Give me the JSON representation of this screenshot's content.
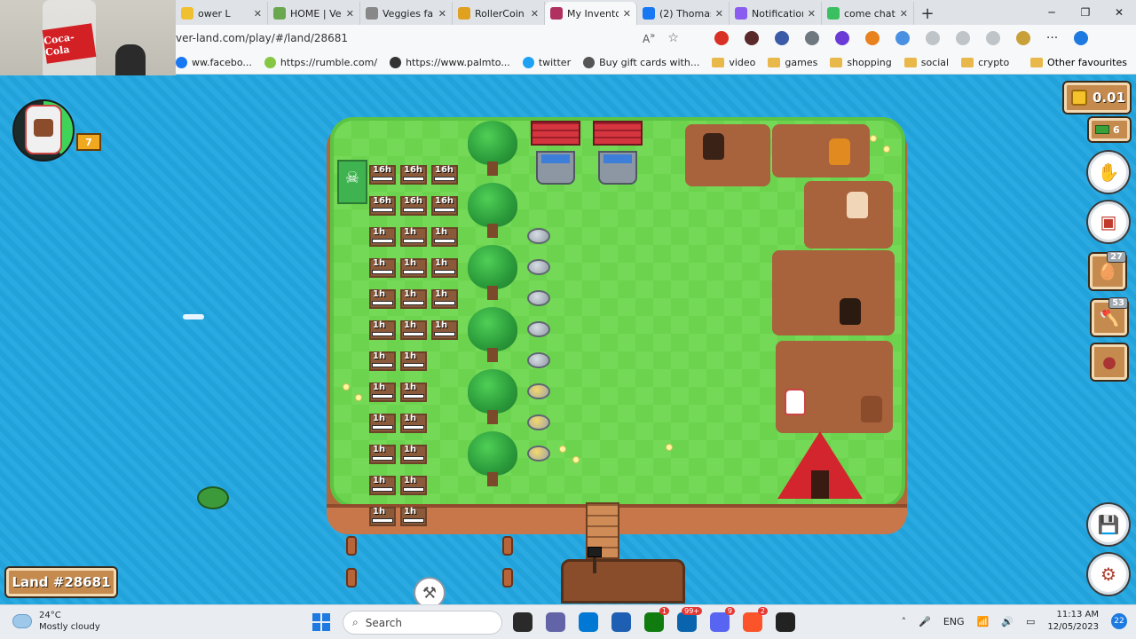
{
  "browser": {
    "tabs": [
      {
        "label": "ower L",
        "color": "#f0c030",
        "active": false
      },
      {
        "label": "HOME | Veg",
        "color": "#6aa84f",
        "active": false
      },
      {
        "label": "Veggies far",
        "color": "#888888",
        "active": false
      },
      {
        "label": "RollerCoin",
        "color": "#e0a020",
        "active": false
      },
      {
        "label": "My Inventor",
        "color": "#b03060",
        "active": true
      },
      {
        "label": "(2) Thomas",
        "color": "#1877f2",
        "active": false
      },
      {
        "label": "Notification",
        "color": "#8a5cf0",
        "active": false
      },
      {
        "label": "come chat",
        "color": "#3ac060",
        "active": false
      }
    ],
    "url": "ver-land.com/play/#/land/28681",
    "bookmarks": [
      {
        "label": "ww.facebo...",
        "icon": "facebook-icon"
      },
      {
        "label": "https://rumble.com/",
        "icon": "rumble-icon"
      },
      {
        "label": "https://www.palmto...",
        "icon": "palmtop-icon"
      },
      {
        "label": "twitter",
        "icon": "twitter-icon"
      },
      {
        "label": "Buy gift cards with...",
        "icon": "giftcard-icon"
      },
      {
        "label": "video",
        "icon": "folder-icon"
      },
      {
        "label": "games",
        "icon": "folder-icon"
      },
      {
        "label": "shopping",
        "icon": "folder-icon"
      },
      {
        "label": "social",
        "icon": "folder-icon"
      },
      {
        "label": "crypto",
        "icon": "folder-icon"
      }
    ],
    "other_bookmarks": "Other favourites",
    "window_controls": {
      "minimize": "─",
      "restore": "❐",
      "close": "✕"
    },
    "new_tab": "+"
  },
  "webcam": {
    "bottle_label": "Coca-Cola"
  },
  "game": {
    "plots": [
      {
        "time": "16h"
      },
      {
        "time": "16h"
      },
      {
        "time": "16h"
      },
      {
        "time": "16h"
      },
      {
        "time": "16h"
      },
      {
        "time": "16h"
      },
      {
        "time": "1h"
      },
      {
        "time": "1h"
      },
      {
        "time": "1h"
      },
      {
        "time": "1h"
      },
      {
        "time": "1h"
      },
      {
        "time": "1h"
      },
      {
        "time": "1h"
      },
      {
        "time": "1h"
      },
      {
        "time": "1h"
      },
      {
        "time": "1h"
      },
      {
        "time": "1h"
      },
      {
        "time": "1h"
      },
      {
        "time": "1h"
      },
      {
        "time": "1h"
      },
      {
        "time": "1h"
      },
      {
        "time": "1h"
      },
      {
        "time": "1h"
      },
      {
        "time": "1h"
      },
      {
        "time": "1h"
      },
      {
        "time": "1h"
      },
      {
        "time": "1h"
      },
      {
        "time": "1h"
      },
      {
        "time": "1h"
      },
      {
        "time": "1h"
      }
    ],
    "player": {
      "level": "7"
    },
    "land_label": "Land #28681",
    "balance": "0.01",
    "cash": "6",
    "inventory_counts": {
      "eggs": "27",
      "wood": "53"
    }
  },
  "taskbar": {
    "weather_temp": "24°C",
    "weather_desc": "Mostly cloudy",
    "search_placeholder": "Search",
    "language": "ENG",
    "time": "11:13 AM",
    "date": "12/05/2023",
    "notifications": "22",
    "app_badges": {
      "xbox": "1",
      "mail": "99+",
      "discord": "9",
      "brave": "2"
    }
  }
}
